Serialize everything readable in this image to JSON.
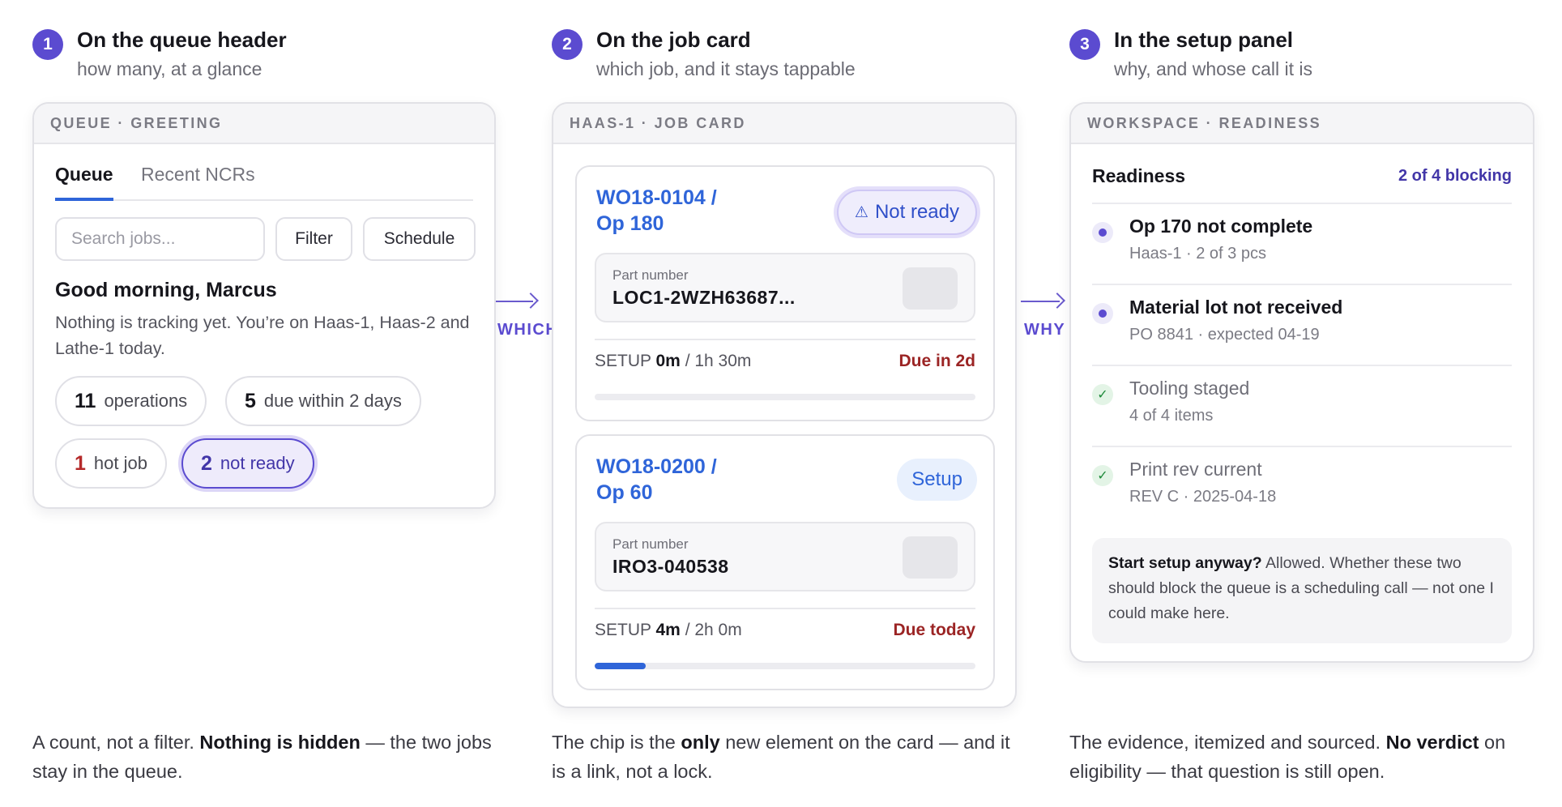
{
  "steps": [
    {
      "num": "1",
      "title": "On the queue header",
      "subtitle": "how many, at a glance"
    },
    {
      "num": "2",
      "title": "On the job card",
      "subtitle": "which job, and it stays tappable"
    },
    {
      "num": "3",
      "title": "In the setup panel",
      "subtitle": "why, and whose call it is"
    }
  ],
  "queue_panel": {
    "header": "QUEUE · GREETING",
    "tabs": [
      "Queue",
      "Recent NCRs"
    ],
    "search_placeholder": "Search jobs...",
    "filter_label": "Filter",
    "schedule_label": "Schedule",
    "greeting": "Good morning, Marcus",
    "greeting_sub": "Nothing is tracking yet. You’re on Haas-1, Haas-2 and Lathe-1 today.",
    "chips": [
      {
        "count": "11",
        "label": "operations"
      },
      {
        "count": "5",
        "label": "due within 2 days"
      },
      {
        "count": "1",
        "label": "hot job"
      },
      {
        "count": "2",
        "label": "not ready"
      }
    ]
  },
  "arrows": {
    "which": "WHICH",
    "why": "WHY"
  },
  "job_panel": {
    "header": "HAAS-1 · JOB CARD",
    "jobs": [
      {
        "title_line1": "WO18-0104 /",
        "title_line2": "Op 180",
        "badge_icon": "⚠",
        "badge": "Not ready",
        "part_label": "Part number",
        "part_number": "LOC1-2WZH63687...",
        "setup_label": "SETUP",
        "setup_elapsed": "0m",
        "setup_total": "/ 1h 30m",
        "due": "Due in 2d",
        "progress": 0
      },
      {
        "title_line1": "WO18-0200 /",
        "title_line2": "Op 60",
        "badge": "Setup",
        "part_label": "Part number",
        "part_number": "IRO3-040538",
        "setup_label": "SETUP",
        "setup_elapsed": "4m",
        "setup_total": "/ 2h 0m",
        "due": "Due today",
        "progress": 0.133
      }
    ]
  },
  "readiness_panel": {
    "header": "WORKSPACE · READINESS",
    "title": "Readiness",
    "count": "2 of 4 blocking",
    "items": [
      {
        "status": "blocking",
        "title": "Op 170 not complete",
        "sub": "Haas-1 · 2 of 3 pcs"
      },
      {
        "status": "blocking",
        "title": "Material lot not received",
        "sub": "PO 8841 · expected 04-19"
      },
      {
        "status": "ok",
        "title": "Tooling staged",
        "sub": "4 of 4 items"
      },
      {
        "status": "ok",
        "title": "Print rev current",
        "sub": "REV C · 2025-04-18"
      }
    ],
    "note_bold": "Start setup anyway?",
    "note_text": " Allowed. Whether these two should block the queue is a scheduling call — not one I could make here."
  },
  "captions": [
    {
      "pre": "A count, not a filter. ",
      "bold": "Nothing is hidden",
      "post": " — the two jobs stay in the queue."
    },
    {
      "pre": "The chip is the ",
      "bold": "only",
      "post": " new element on the card — and it is a link, not a lock."
    },
    {
      "pre": "The evidence, itemized and sourced. ",
      "bold": "No verdict",
      "post": " on eligibility — that question is still open."
    }
  ],
  "colors": {
    "accent": "#5b4bd0",
    "link_blue": "#2f65d9",
    "due_red": "#9b2424",
    "ok_green": "#1e8a3a"
  }
}
